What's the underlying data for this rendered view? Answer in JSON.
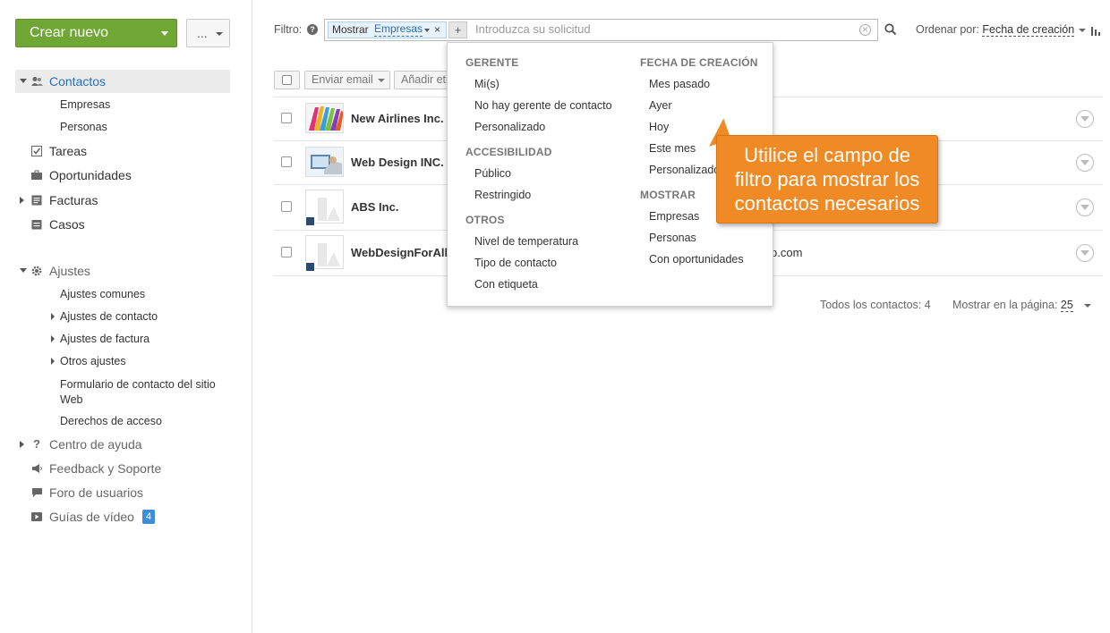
{
  "sidebar": {
    "create_label": "Crear nuevo",
    "more_label": "...",
    "nav": {
      "contactos": "Contactos",
      "empresas": "Empresas",
      "personas": "Personas",
      "tareas": "Tareas",
      "oportunidades": "Oportunidades",
      "facturas": "Facturas",
      "casos": "Casos",
      "ajustes": "Ajustes",
      "ajustes_comunes": "Ajustes comunes",
      "ajustes_contacto": "Ajustes de contacto",
      "ajustes_factura": "Ajustes de factura",
      "otros_ajustes": "Otros ajustes",
      "formulario_line1": "Formulario de contacto del sitio",
      "formulario_line2": "Web",
      "derechos": "Derechos de acceso",
      "centro_ayuda": "Centro de ayuda",
      "feedback": "Feedback y Soporte",
      "foro": "Foro de usuarios",
      "guias": "Guías de vídeo",
      "guias_badge": "4"
    }
  },
  "filter": {
    "label": "Filtro:",
    "chip_key": "Mostrar",
    "chip_value": "Empresas",
    "chip_close": "×",
    "plus": "+",
    "placeholder": "Introduzca su solicitud",
    "sort_label": "Ordenar por:",
    "sort_value": "Fecha de creación"
  },
  "toolbar": {
    "enviar_email": "Enviar email",
    "anadir": "Añadir etiqueta"
  },
  "rows": [
    {
      "name": "New Airlines Inc.",
      "email": ""
    },
    {
      "name": "Web Design INC.",
      "email": ""
    },
    {
      "name": "ABS Inc.",
      "email": ""
    },
    {
      "name": "WebDesignForAll",
      "email": "p.com"
    }
  ],
  "footer": {
    "total": "Todos los contactos: 4",
    "per_page_label": "Mostrar en la página:",
    "per_page_value": "25"
  },
  "popup": {
    "gerente": {
      "head": "GERENTE",
      "items": [
        "Mi(s)",
        "No hay gerente de contacto",
        "Personalizado"
      ]
    },
    "accesibilidad": {
      "head": "ACCESIBILIDAD",
      "items": [
        "Público",
        "Restringido"
      ]
    },
    "otros": {
      "head": "OTROS",
      "items": [
        "Nivel de temperatura",
        "Tipo de contacto",
        "Con etiqueta"
      ]
    },
    "fecha": {
      "head": "FECHA DE CREACIÓN",
      "items": [
        "Mes pasado",
        "Ayer",
        "Hoy",
        "Este mes",
        "Personalizado"
      ]
    },
    "mostrar": {
      "head": "MOSTRAR",
      "items": [
        "Empresas",
        "Personas",
        "Con oportunidades"
      ]
    }
  },
  "callout": {
    "line1": "Utilice el campo de",
    "line2": "filtro para mostrar los",
    "line3": "contactos necesarios"
  },
  "colors": {
    "create_button": "#6fa636",
    "active_link": "#2a6eb5",
    "callout": "#f08a24",
    "badge": "#3d8ed6"
  }
}
